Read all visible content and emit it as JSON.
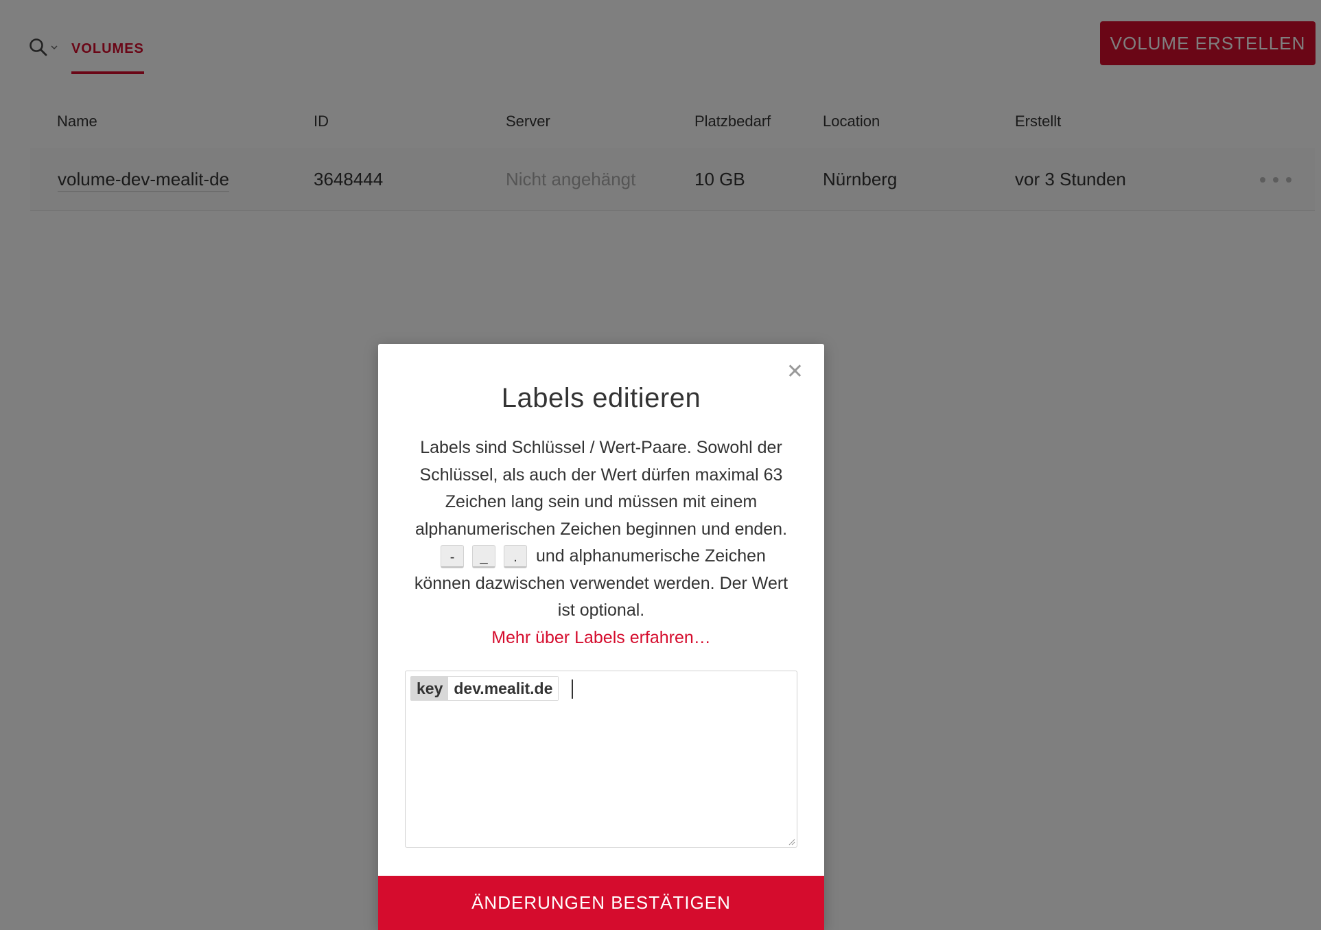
{
  "toolbar": {
    "search_icon": "search-icon",
    "dropdown_icon": "chevron-down-icon",
    "tab_label": "VOLUMES",
    "create_button": "VOLUME ERSTELLEN"
  },
  "table": {
    "columns": [
      "Name",
      "ID",
      "Server",
      "Platzbedarf",
      "Location",
      "Erstellt"
    ],
    "rows": [
      {
        "name": "volume-dev-mealit-de",
        "id": "3648444",
        "server": "Nicht angehängt",
        "size": "10 GB",
        "location": "Nürnberg",
        "created": "vor 3 Stunden"
      }
    ],
    "row_menu_icon": "more-horizontal-icon"
  },
  "modal": {
    "title": "Labels editieren",
    "desc_line1": "Labels sind Schlüssel / Wert-Paare. Sowohl der",
    "desc_line2": "Schlüssel, als auch der Wert dürfen maximal 63",
    "desc_line3": "Zeichen lang sein und müssen mit einem",
    "desc_line4": "alphanumerischen Zeichen beginnen und enden.",
    "chars": [
      "-",
      "_",
      "."
    ],
    "desc_line5_suffix": "und alphanumerische Zeichen",
    "desc_line6": "können dazwischen verwendet werden. Der Wert",
    "desc_line7": "ist optional.",
    "link": "Mehr über Labels erfahren…",
    "labels": [
      {
        "key": "key",
        "value": "dev.mealit.de"
      }
    ],
    "confirm_button": "ÄNDERUNGEN BESTÄTIGEN",
    "close_icon": "close-icon"
  },
  "colors": {
    "accent": "#d50c2d",
    "overlay": "rgba(0,0,0,0.5)"
  }
}
